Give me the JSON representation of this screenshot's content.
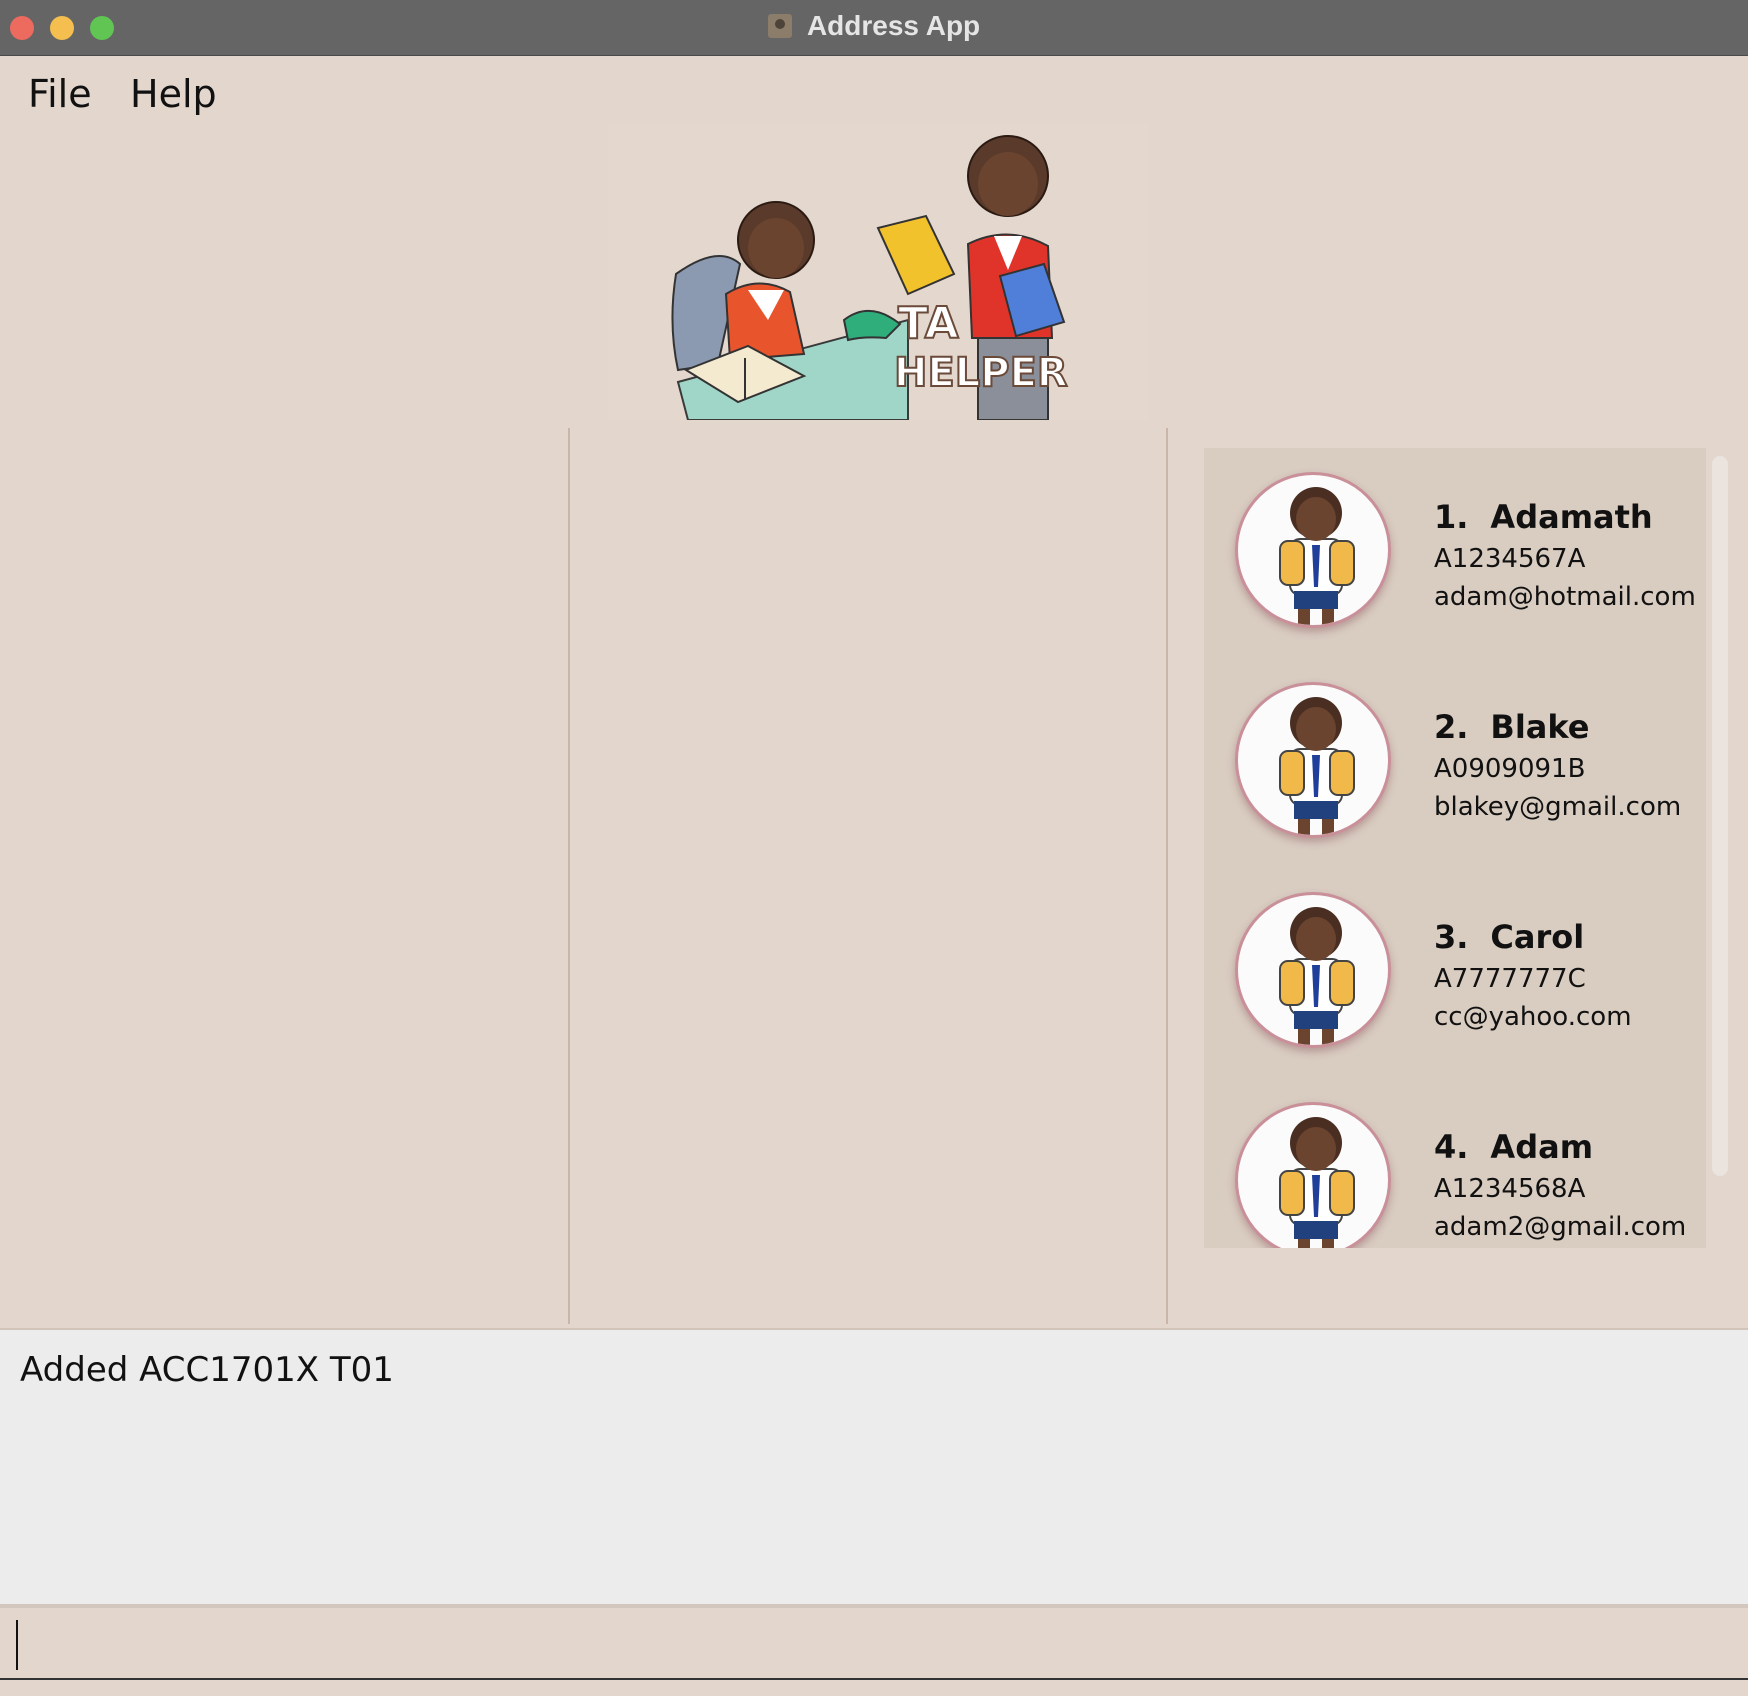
{
  "window": {
    "title": "Address App"
  },
  "menu": {
    "file": "File",
    "help": "Help"
  },
  "logo": {
    "line1": "TA",
    "line2": "HELPER"
  },
  "persons": [
    {
      "index": "1.",
      "name": "Adamath",
      "id": "A1234567A",
      "email": "adam@hotmail.com"
    },
    {
      "index": "2.",
      "name": "Blake",
      "id": "A0909091B",
      "email": "blakey@gmail.com"
    },
    {
      "index": "3.",
      "name": "Carol",
      "id": "A7777777C",
      "email": "cc@yahoo.com"
    },
    {
      "index": "4.",
      "name": "Adam",
      "id": "A1234568A",
      "email": "adam2@gmail.com"
    }
  ],
  "result": {
    "message": "Added ACC1701X T01"
  },
  "command": {
    "value": ""
  },
  "colors": {
    "background": "#e2d6cd",
    "list_background": "#d9ccc1",
    "avatar_border": "#c9909a",
    "result_background": "#ececec"
  }
}
